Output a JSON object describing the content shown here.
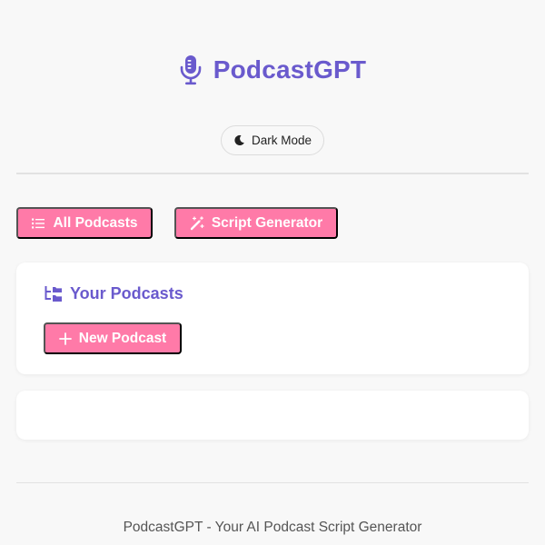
{
  "header": {
    "title": "PodcastGPT",
    "icon": "microphone-icon",
    "accent_color": "#6a5acd"
  },
  "theme_toggle": {
    "label": "Dark Mode",
    "icon": "moon-icon"
  },
  "nav": {
    "all_podcasts_label": "All Podcasts",
    "all_podcasts_icon": "list-icon",
    "script_generator_label": "Script Generator",
    "script_generator_icon": "magic-wand-icon",
    "button_color": "#ff7aa8"
  },
  "podcasts_section": {
    "title": "Your Podcasts",
    "icon": "folder-tree-icon",
    "new_button_label": "New Podcast",
    "new_button_icon": "plus-icon"
  },
  "footer": {
    "text": "PodcastGPT - Your AI Podcast Script Generator"
  }
}
